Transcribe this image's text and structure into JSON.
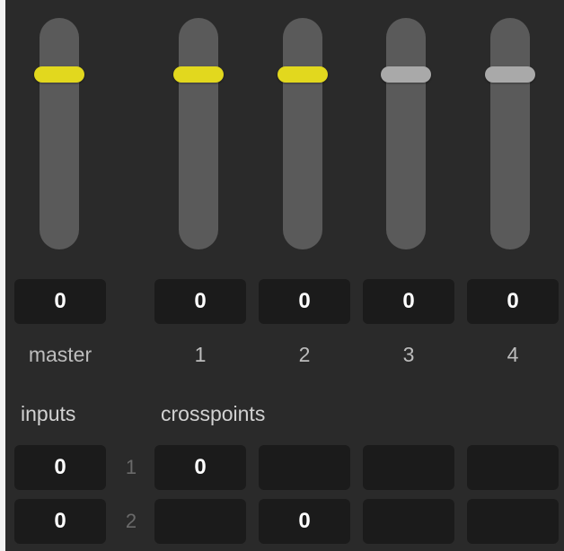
{
  "colors": {
    "panel_bg": "#2a2a2a",
    "track": "#5a5a5a",
    "knob_active": "#e2d81e",
    "knob_inactive": "#a9a9a9",
    "box_bg": "#1b1b1b"
  },
  "faders": [
    {
      "label": "master",
      "value": "0",
      "active": true
    },
    {
      "label": "1",
      "value": "0",
      "active": true
    },
    {
      "label": "2",
      "value": "0",
      "active": true
    },
    {
      "label": "3",
      "value": "0",
      "active": false
    },
    {
      "label": "4",
      "value": "0",
      "active": false
    }
  ],
  "sections": {
    "inputs_label": "inputs",
    "crosspoints_label": "crosspoints"
  },
  "inputs": [
    {
      "row": "1",
      "value": "0"
    },
    {
      "row": "2",
      "value": "0"
    }
  ],
  "crosspoints": [
    [
      "0",
      "",
      "",
      ""
    ],
    [
      "",
      "0",
      "",
      ""
    ]
  ]
}
